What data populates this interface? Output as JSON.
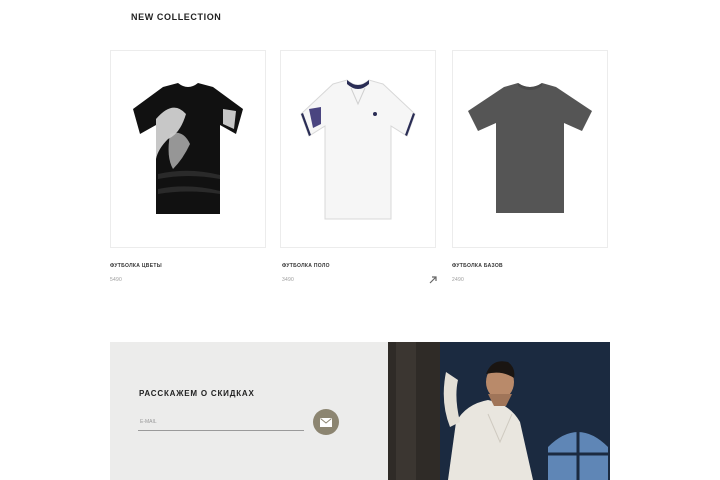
{
  "section": {
    "title": "NEW COLLECTION"
  },
  "products": [
    {
      "name": "ФУТБОЛКА ЦВЕТЫ",
      "price": "5490"
    },
    {
      "name": "ФУТБОЛКА ПОЛО",
      "price": "3490"
    },
    {
      "name": "ФУТБОЛКА БАЗОВ",
      "price": "2490"
    }
  ],
  "icons": {
    "cart": "cart-icon",
    "send": "envelope-icon"
  },
  "newsletter": {
    "title": "РАССКАЖЕМ О СКИДКАХ",
    "email_placeholder": "E-MAIL"
  },
  "colors": {
    "accent": "#8c8571",
    "promo_bg": "#ececeb",
    "photo_bg": "#1b2a40"
  }
}
